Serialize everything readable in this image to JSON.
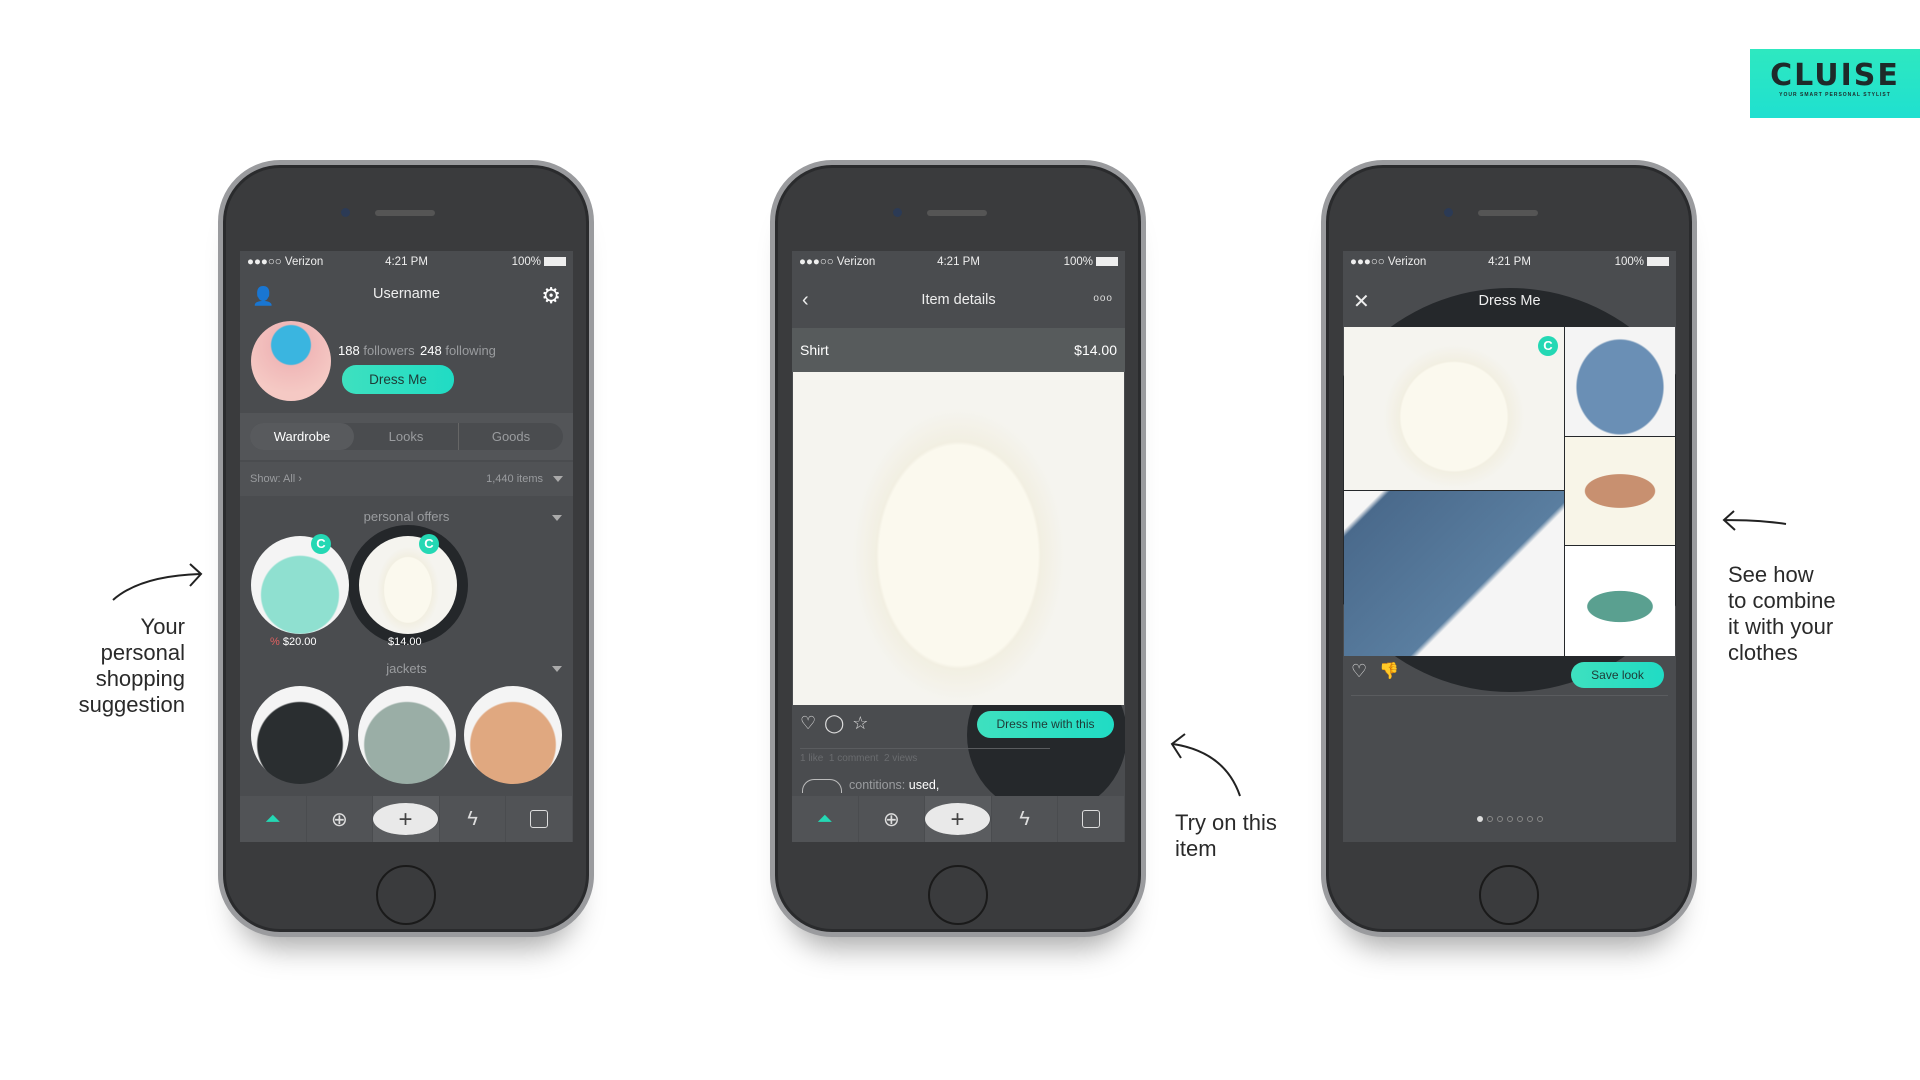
{
  "logo": {
    "name": "CLUISE",
    "tagline": "YOUR SMART PERSONAL STYLIST",
    "color": "#2ee8c0"
  },
  "status_bar": {
    "carrier": "●●●○○ Verizon",
    "time": "4:21 PM",
    "battery": "100%"
  },
  "accent": "#24d8b4",
  "screen_profile": {
    "title": "Username",
    "followers_count": "188",
    "followers_label": "followers",
    "following_count": "248",
    "following_label": "following",
    "dress_me": "Dress Me",
    "tabs": [
      "Wardrobe",
      "Looks",
      "Goods"
    ],
    "show": "Show: All",
    "items_count": "1,440 items",
    "section1": "personal offers",
    "offers": [
      {
        "discount": "%",
        "price": "$20.00"
      },
      {
        "price": "$14.00"
      }
    ],
    "section2": "jackets",
    "badge": "C"
  },
  "screen_item": {
    "title": "Item details",
    "more": "ooo",
    "item_name": "Shirt",
    "item_price": "$14.00",
    "dress_button": "Dress me with this",
    "likes": "1 like",
    "comments": "1 comment",
    "views": "2 views",
    "conditions_label": "contitions:",
    "conditions_value": "used,"
  },
  "screen_dressme": {
    "title": "Dress Me",
    "save": "Save look",
    "badge": "C",
    "pages": 7,
    "current_page": 1
  },
  "tabbar": [
    "hanger-icon",
    "globe-icon",
    "plus-icon",
    "lightning-icon",
    "bag-icon"
  ],
  "annotations": {
    "left": [
      "Your",
      "personal",
      "shopping",
      "suggestion"
    ],
    "middle": [
      "Try on this",
      "item"
    ],
    "right": [
      "See how",
      "to combine",
      "it with your",
      "clothes"
    ]
  }
}
